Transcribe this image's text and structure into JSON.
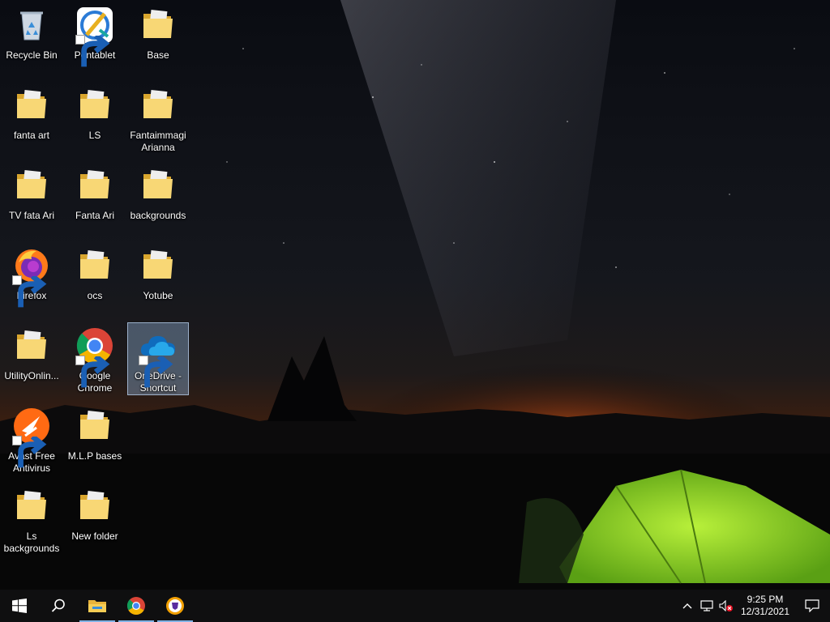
{
  "desktop": {
    "icons": [
      {
        "id": "recycle-bin",
        "label": "Recycle Bin",
        "icon": "recycle-bin-icon",
        "shortcut": false
      },
      {
        "id": "pentablet",
        "label": "Pentablet",
        "icon": "pentablet-icon",
        "shortcut": true
      },
      {
        "id": "base",
        "label": "Base",
        "icon": "folder-icon",
        "shortcut": false
      },
      {
        "id": "fanta-art",
        "label": "fanta art",
        "icon": "folder-icon",
        "shortcut": false
      },
      {
        "id": "ls",
        "label": "LS",
        "icon": "folder-icon",
        "shortcut": false
      },
      {
        "id": "fantaimmagi-arianna",
        "label": "Fantaimmagi Arianna",
        "icon": "folder-icon",
        "shortcut": false
      },
      {
        "id": "tv-fata-ari",
        "label": "TV  fata Ari",
        "icon": "folder-icon",
        "shortcut": false
      },
      {
        "id": "fanta-ari",
        "label": "Fanta Ari",
        "icon": "folder-icon",
        "shortcut": false
      },
      {
        "id": "backgrounds",
        "label": "backgrounds",
        "icon": "folder-icon",
        "shortcut": false
      },
      {
        "id": "firefox",
        "label": "Firefox",
        "icon": "firefox-icon",
        "shortcut": true
      },
      {
        "id": "ocs",
        "label": "ocs",
        "icon": "folder-icon",
        "shortcut": false
      },
      {
        "id": "yotube",
        "label": "Yotube",
        "icon": "folder-icon",
        "shortcut": false
      },
      {
        "id": "utilityonline",
        "label": "UtilityOnlin...",
        "icon": "folder-icon",
        "shortcut": false
      },
      {
        "id": "google-chrome",
        "label": "Google Chrome",
        "icon": "chrome-icon",
        "shortcut": true
      },
      {
        "id": "onedrive-shortcut",
        "label": "OneDrive - Shortcut",
        "icon": "onedrive-icon",
        "shortcut": true,
        "selected": true
      },
      {
        "id": "avast",
        "label": "Avast Free Antivirus",
        "icon": "avast-icon",
        "shortcut": true
      },
      {
        "id": "mlp-bases",
        "label": "M.L.P bases",
        "icon": "folder-icon",
        "shortcut": false
      },
      {
        "id": "ls-backgrounds",
        "label": "Ls backgrounds",
        "icon": "folder-icon",
        "shortcut": false
      },
      {
        "id": "new-folder",
        "label": "New folder",
        "icon": "folder-icon",
        "shortcut": false
      }
    ]
  },
  "taskbar": {
    "start": "start-icon",
    "search": "search-icon",
    "pinned": [
      {
        "name": "file-explorer",
        "icon": "file-explorer-icon",
        "running": true
      },
      {
        "name": "chrome",
        "icon": "chrome-icon",
        "running": true
      },
      {
        "name": "brave",
        "icon": "brave-icon",
        "running": true
      }
    ],
    "tray": {
      "icons": [
        "chevron-up-icon",
        "network-icon",
        "volume-muted-icon"
      ],
      "time": "9:25 PM",
      "date": "12/31/2021",
      "notification_icon": "action-center-icon"
    }
  },
  "colors": {
    "taskbar_bg": "#0f0f10",
    "running_indicator": "#7fb2e5",
    "tent_green": "#7ed321",
    "horizon_orange": "#e8661c"
  }
}
